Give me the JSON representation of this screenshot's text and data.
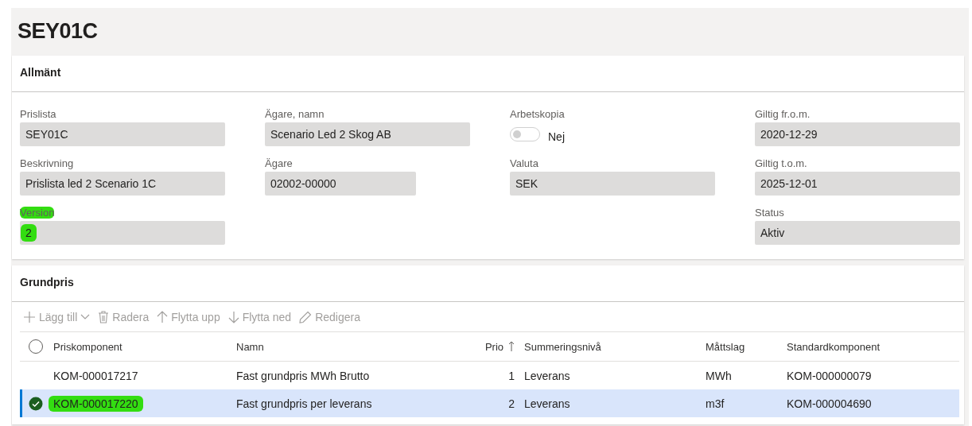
{
  "title": "SEY01C",
  "general": {
    "heading": "Allmänt",
    "columns": [
      [
        {
          "kind": "field",
          "label": "Prislista",
          "value": "SEY01C",
          "highlighted": false
        },
        {
          "kind": "field",
          "label": "Beskrivning",
          "value": "Prislista led 2 Scenario 1C",
          "highlighted": false
        },
        {
          "kind": "field",
          "label": "Version",
          "value": "2",
          "highlighted": true
        }
      ],
      [
        {
          "kind": "field",
          "label": "Ägare, namn",
          "value": "Scenario Led 2 Skog AB",
          "highlighted": false
        },
        {
          "kind": "short_field",
          "label": "Ägare",
          "value": "02002-00000",
          "highlighted": false
        }
      ],
      [
        {
          "kind": "toggle",
          "label": "Arbetskopia",
          "value": "Nej",
          "on": false
        },
        {
          "kind": "field",
          "label": "Valuta",
          "value": "SEK",
          "highlighted": false
        }
      ],
      [
        {
          "kind": "field",
          "label": "Giltig fr.o.m.",
          "value": "2020-12-29",
          "highlighted": false
        },
        {
          "kind": "field",
          "label": "Giltig t.o.m.",
          "value": "2025-12-01",
          "highlighted": false
        },
        {
          "kind": "field",
          "label": "Status",
          "value": "Aktiv",
          "highlighted": false
        }
      ]
    ]
  },
  "prices": {
    "heading": "Grundpris",
    "toolbar": [
      {
        "kind": "add",
        "label": "Lägg till",
        "disabled": true
      },
      {
        "kind": "delete",
        "label": "Radera",
        "disabled": true
      },
      {
        "kind": "up",
        "label": "Flytta upp",
        "disabled": true
      },
      {
        "kind": "down",
        "label": "Flytta ned",
        "disabled": true
      },
      {
        "kind": "edit",
        "label": "Redigera",
        "disabled": true
      }
    ],
    "select_all": {
      "selected": false
    },
    "columns": [
      {
        "label": "Priskomponent",
        "sorted": false
      },
      {
        "label": "Namn",
        "sorted": false
      },
      {
        "label": "Prio",
        "sorted": true
      },
      {
        "label": "Summeringsnivå",
        "sorted": false
      },
      {
        "label": "Måttslag",
        "sorted": false
      },
      {
        "label": "Standardkomponent",
        "sorted": false
      }
    ],
    "rows": [
      {
        "selected": false,
        "highlighted": false,
        "cells": [
          "KOM-000017217",
          "Fast grundpris MWh Brutto",
          "1",
          "Leverans",
          "MWh",
          "KOM-000000079"
        ]
      },
      {
        "selected": true,
        "highlighted": true,
        "cells": [
          "KOM-000017220",
          "Fast grundpris per leverans",
          "2",
          "Leverans",
          "m3f",
          "KOM-000004690"
        ]
      }
    ]
  }
}
